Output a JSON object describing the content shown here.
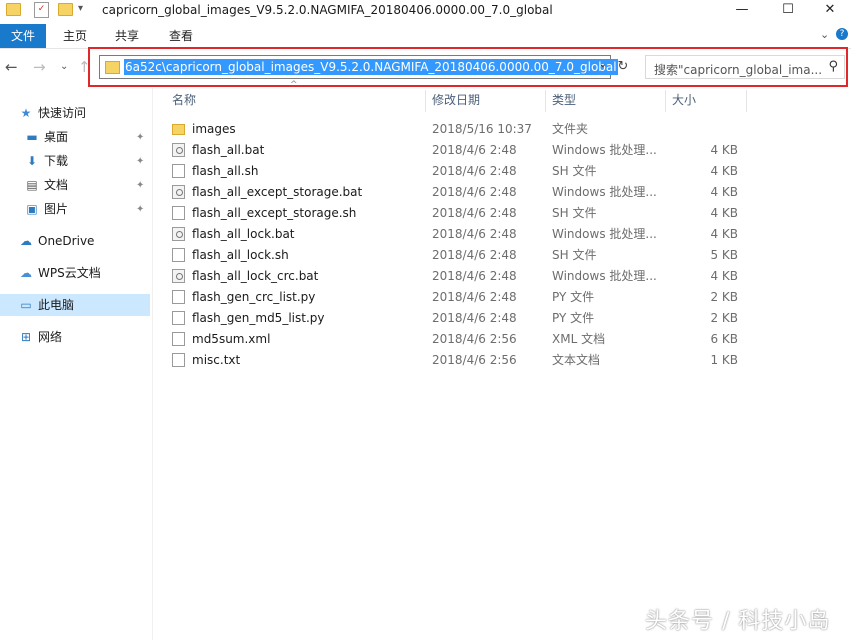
{
  "window": {
    "title": "capricorn_global_images_V9.5.2.0.NAGMIFA_20180406.0000.00_7.0_global",
    "minimize_glyph": "—",
    "maximize_glyph": "☐",
    "close_glyph": "✕"
  },
  "quick_access_toolbar": {
    "dropdown_glyph": "▾"
  },
  "ribbon": {
    "tabs": [
      "文件",
      "主页",
      "共享",
      "查看"
    ],
    "collapse_glyph": "⌄",
    "help_glyph": "?"
  },
  "address_bar": {
    "path": "6a52c\\capricorn_global_images_V9.5.2.0.NAGMIFA_20180406.0000.00_7.0_global",
    "dropdown_glyph": "⌄",
    "refresh_glyph": "↻"
  },
  "search": {
    "placeholder": "搜索\"capricorn_global_ima...",
    "icon_glyph": "⚲"
  },
  "sidebar": {
    "items": [
      {
        "label": "快速访问",
        "icon": "star-icon",
        "glyph": "★",
        "color": "#3c8ad8"
      },
      {
        "label": "桌面",
        "icon": "desktop-icon",
        "glyph": "▬",
        "color": "#2f7bc0",
        "pinned": true
      },
      {
        "label": "下载",
        "icon": "download-icon",
        "glyph": "⬇",
        "color": "#2f7bc0",
        "pinned": true
      },
      {
        "label": "文档",
        "icon": "document-icon",
        "glyph": "▤",
        "color": "#555555",
        "pinned": true
      },
      {
        "label": "图片",
        "icon": "picture-icon",
        "glyph": "▣",
        "color": "#2f7bc0",
        "pinned": true
      },
      {
        "label": "OneDrive",
        "icon": "cloud-icon",
        "glyph": "☁",
        "color": "#2f7bc0"
      },
      {
        "label": "WPS云文档",
        "icon": "wps-cloud-icon",
        "glyph": "☁",
        "color": "#4a8fd6"
      },
      {
        "label": "此电脑",
        "icon": "computer-icon",
        "glyph": "▭",
        "color": "#2f7bc0",
        "selected": true
      },
      {
        "label": "网络",
        "icon": "network-icon",
        "glyph": "⊞",
        "color": "#2f7bc0"
      }
    ],
    "pin_glyph": "✦"
  },
  "columns": {
    "name": "名称",
    "modified": "修改日期",
    "type": "类型",
    "size": "大小",
    "sort_glyph": "^"
  },
  "files": [
    {
      "name": "images",
      "modified": "2018/5/16 10:37",
      "type": "文件夹",
      "size": "",
      "icon": "folder-icon"
    },
    {
      "name": "flash_all.bat",
      "modified": "2018/4/6 2:48",
      "type": "Windows 批处理...",
      "size": "4 KB",
      "icon": "bat-file-icon"
    },
    {
      "name": "flash_all.sh",
      "modified": "2018/4/6 2:48",
      "type": "SH 文件",
      "size": "4 KB",
      "icon": "file-icon"
    },
    {
      "name": "flash_all_except_storage.bat",
      "modified": "2018/4/6 2:48",
      "type": "Windows 批处理...",
      "size": "4 KB",
      "icon": "bat-file-icon"
    },
    {
      "name": "flash_all_except_storage.sh",
      "modified": "2018/4/6 2:48",
      "type": "SH 文件",
      "size": "4 KB",
      "icon": "file-icon"
    },
    {
      "name": "flash_all_lock.bat",
      "modified": "2018/4/6 2:48",
      "type": "Windows 批处理...",
      "size": "4 KB",
      "icon": "bat-file-icon"
    },
    {
      "name": "flash_all_lock.sh",
      "modified": "2018/4/6 2:48",
      "type": "SH 文件",
      "size": "5 KB",
      "icon": "file-icon"
    },
    {
      "name": "flash_all_lock_crc.bat",
      "modified": "2018/4/6 2:48",
      "type": "Windows 批处理...",
      "size": "4 KB",
      "icon": "bat-file-icon"
    },
    {
      "name": "flash_gen_crc_list.py",
      "modified": "2018/4/6 2:48",
      "type": "PY 文件",
      "size": "2 KB",
      "icon": "file-icon"
    },
    {
      "name": "flash_gen_md5_list.py",
      "modified": "2018/4/6 2:48",
      "type": "PY 文件",
      "size": "2 KB",
      "icon": "file-icon"
    },
    {
      "name": "md5sum.xml",
      "modified": "2018/4/6 2:56",
      "type": "XML 文档",
      "size": "6 KB",
      "icon": "xml-file-icon"
    },
    {
      "name": "misc.txt",
      "modified": "2018/4/6 2:56",
      "type": "文本文档",
      "size": "1 KB",
      "icon": "text-file-icon"
    }
  ],
  "watermark": "头条号 / 科技小岛",
  "colors": {
    "accent": "#1979ca",
    "highlight_box": "#e0282a",
    "selection": "#3399ff"
  }
}
